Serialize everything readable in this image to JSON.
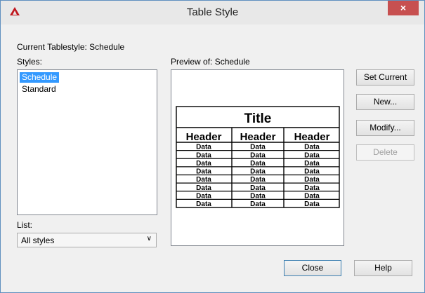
{
  "window": {
    "title": "Table Style",
    "close_glyph": "×"
  },
  "current_tablestyle": "Current Tablestyle: Schedule",
  "styles": {
    "label": "Styles:",
    "items": [
      {
        "label": "Schedule",
        "selected": true
      },
      {
        "label": "Standard",
        "selected": false
      }
    ]
  },
  "list": {
    "label": "List:",
    "selected": "All styles"
  },
  "preview": {
    "label": "Preview of: Schedule",
    "table_title": "Title",
    "headers": [
      "Header",
      "Header",
      "Header"
    ],
    "data_text": "Data",
    "data_rows": 8
  },
  "buttons": {
    "set_current": "Set Current",
    "new": "New...",
    "modify": "Modify...",
    "delete": "Delete",
    "close": "Close",
    "help": "Help"
  },
  "colors": {
    "selection": "#3399ff",
    "close_button": "#c75050",
    "app_icon": "#c0161d"
  }
}
